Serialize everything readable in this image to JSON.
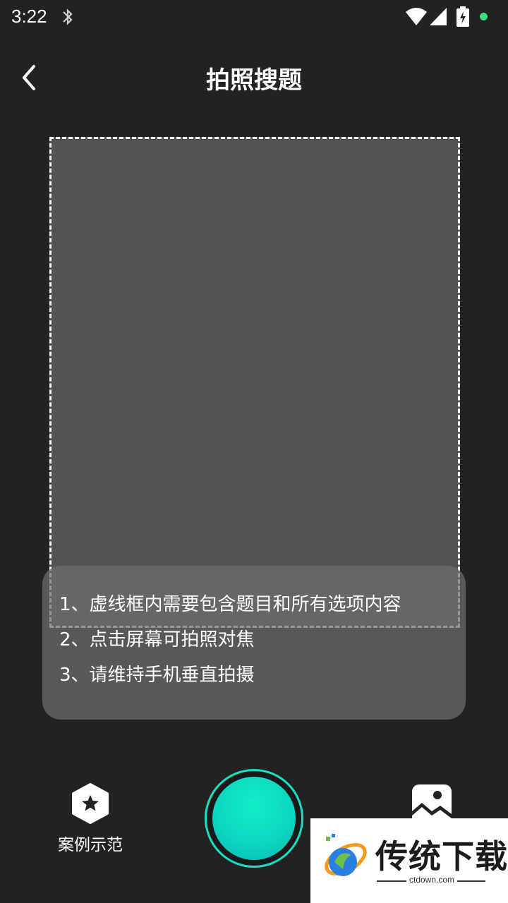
{
  "status_bar": {
    "time": "3:22"
  },
  "header": {
    "title": "拍照搜题"
  },
  "tips": [
    "1、虚线框内需要包含题目和所有选项内容",
    "2、点击屏幕可拍照对焦",
    "3、请维持手机垂直拍摄"
  ],
  "bottom_bar": {
    "examples_label": "案例示范"
  },
  "watermark": {
    "title": "传统下载",
    "domain": "ctdown.com"
  },
  "colors": {
    "background": "#222222",
    "frame_fill": "#535353",
    "shutter_accent": "#17e0c0"
  }
}
